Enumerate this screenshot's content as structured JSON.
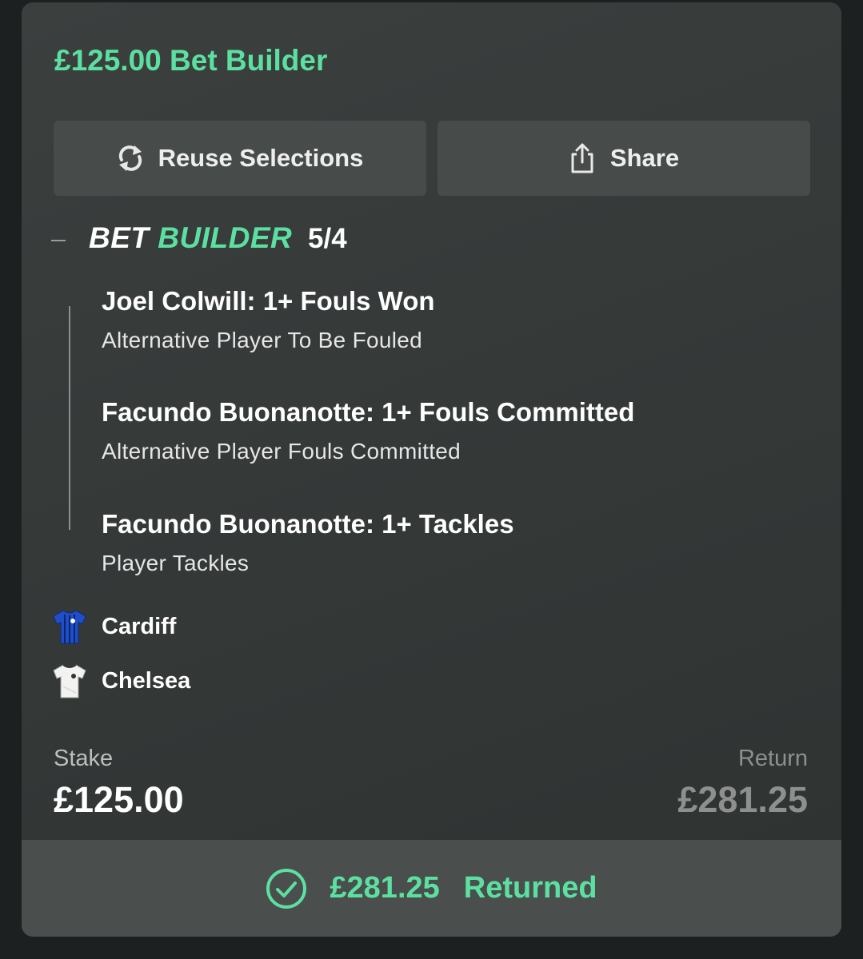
{
  "header": {
    "title": "£125.00 Bet Builder"
  },
  "actions": {
    "reuse_label": "Reuse Selections",
    "share_label": "Share"
  },
  "bet": {
    "label_part1": "BET",
    "label_part2": "BUILDER",
    "odds": "5/4",
    "selections": [
      {
        "name": "Joel Colwill: 1+ Fouls Won",
        "market": "Alternative Player To Be Fouled"
      },
      {
        "name": "Facundo Buonanotte: 1+ Fouls Committed",
        "market": "Alternative Player Fouls Committed"
      },
      {
        "name": "Facundo Buonanotte: 1+ Tackles",
        "market": "Player Tackles"
      }
    ],
    "teams": [
      {
        "name": "Cardiff",
        "icon": "cardiff-shirt-icon"
      },
      {
        "name": "Chelsea",
        "icon": "chelsea-shirt-icon"
      }
    ]
  },
  "summary": {
    "stake_label": "Stake",
    "stake_value": "£125.00",
    "return_label": "Return",
    "return_value": "£281.25"
  },
  "result": {
    "amount": "£281.25",
    "status": "Returned",
    "icon": "check-circle-icon"
  },
  "colors": {
    "accent": "#5ce0a2",
    "card": "#383c3b",
    "button": "#474b4a",
    "muted": "#8d908f"
  }
}
